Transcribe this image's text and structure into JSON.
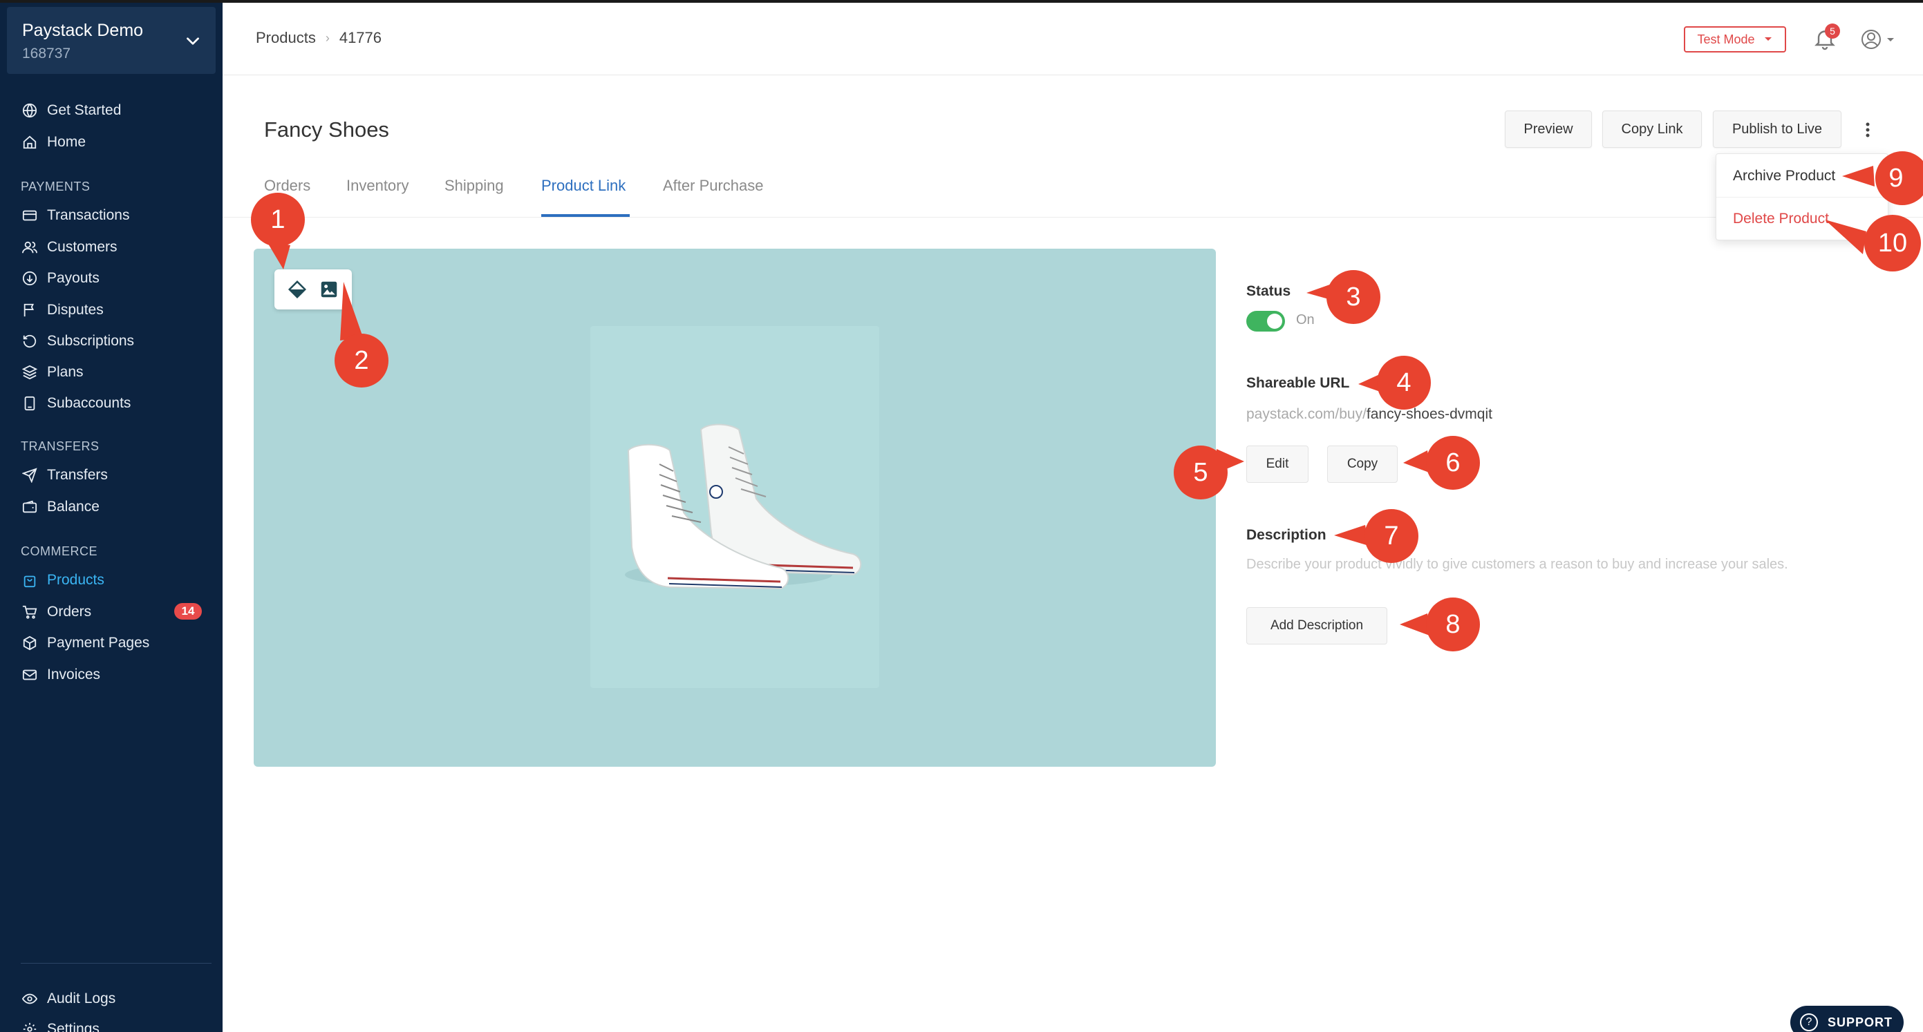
{
  "business": {
    "name": "Paystack Demo",
    "id": "168737"
  },
  "sidebar": {
    "top": [
      {
        "label": "Get Started",
        "icon": "globe-icon"
      },
      {
        "label": "Home",
        "icon": "home-icon"
      }
    ],
    "payments_heading": "PAYMENTS",
    "payments": [
      {
        "label": "Transactions",
        "icon": "card-icon"
      },
      {
        "label": "Customers",
        "icon": "users-icon"
      },
      {
        "label": "Payouts",
        "icon": "payout-icon"
      },
      {
        "label": "Disputes",
        "icon": "flag-icon"
      },
      {
        "label": "Subscriptions",
        "icon": "refresh-icon"
      },
      {
        "label": "Plans",
        "icon": "layers-icon"
      },
      {
        "label": "Subaccounts",
        "icon": "document-icon"
      }
    ],
    "transfers_heading": "TRANSFERS",
    "transfers": [
      {
        "label": "Transfers",
        "icon": "send-icon"
      },
      {
        "label": "Balance",
        "icon": "wallet-icon"
      }
    ],
    "commerce_heading": "COMMERCE",
    "commerce": [
      {
        "label": "Products",
        "icon": "bag-icon",
        "active": true
      },
      {
        "label": "Orders",
        "icon": "cart-icon",
        "badge": "14"
      },
      {
        "label": "Payment Pages",
        "icon": "box-icon"
      },
      {
        "label": "Invoices",
        "icon": "mail-icon"
      }
    ],
    "bottom": [
      {
        "label": "Audit Logs",
        "icon": "eye-icon"
      },
      {
        "label": "Settings",
        "icon": "gear-icon"
      }
    ]
  },
  "topbar": {
    "breadcrumb": [
      "Products",
      "41776"
    ],
    "test_mode": "Test Mode",
    "notification_count": "5"
  },
  "header": {
    "title": "Fancy Shoes",
    "buttons": {
      "preview": "Preview",
      "copy_link": "Copy Link",
      "publish": "Publish to Live"
    }
  },
  "tabs": [
    "Orders",
    "Inventory",
    "Shipping",
    "Product Link",
    "After Purchase"
  ],
  "active_tab": "Product Link",
  "menu": {
    "archive": "Archive Product",
    "delete": "Delete Product"
  },
  "details": {
    "status_label": "Status",
    "status_value": "On",
    "url_label": "Shareable URL",
    "url_base": "paystack.com/buy/",
    "url_slug": "fancy-shoes-dvmqit",
    "edit": "Edit",
    "copy": "Copy",
    "description_label": "Description",
    "description_placeholder": "Describe your product vividly to give customers a reason to buy and increase your sales.",
    "add_description": "Add Description"
  },
  "callouts": [
    "1",
    "2",
    "3",
    "4",
    "5",
    "6",
    "7",
    "8",
    "9",
    "10"
  ],
  "support": "SUPPORT",
  "colors": {
    "sidebar": "#0c2340",
    "accent": "#3bb5f3",
    "tab_active": "#2d6fbf",
    "danger": "#e04848",
    "callout": "#e8432f",
    "toggle_on": "#3fb45f",
    "panel": "#aed6d8"
  }
}
